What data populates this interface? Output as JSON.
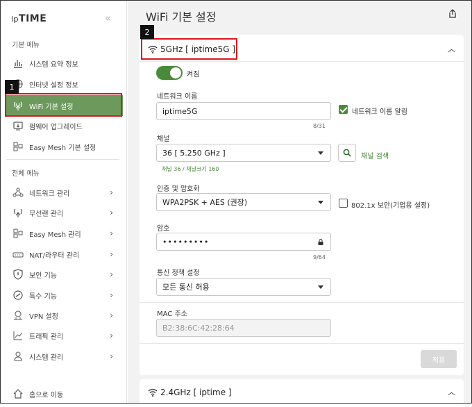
{
  "sidebar": {
    "logo_prefix": "ip",
    "logo_main": "TIME",
    "collapse_glyph": "«",
    "basic_menu_title": "기본 메뉴",
    "basic_items": [
      {
        "label": "시스템 요약 정보",
        "icon": "bar-chart-icon"
      },
      {
        "label": "인터넷 설정 정보",
        "icon": "globe-icon"
      },
      {
        "label": "WiFi 기본 설정",
        "icon": "wifi-antenna-icon"
      },
      {
        "label": "펌웨어 업그레이드",
        "icon": "firmware-icon"
      },
      {
        "label": "Easy Mesh 기본 설정",
        "icon": "mesh-icon"
      }
    ],
    "all_menu_title": "전체 메뉴",
    "all_items": [
      {
        "label": "네트워크 관리",
        "icon": "network-icon"
      },
      {
        "label": "무선랜 관리",
        "icon": "wireless-icon"
      },
      {
        "label": "Easy Mesh 관리",
        "icon": "mesh-icon"
      },
      {
        "label": "NAT/라우터 관리",
        "icon": "router-icon"
      },
      {
        "label": "보안 기능",
        "icon": "shield-icon"
      },
      {
        "label": "특수 기능",
        "icon": "special-icon"
      },
      {
        "label": "VPN 설정",
        "icon": "vpn-icon"
      },
      {
        "label": "트래픽 관리",
        "icon": "traffic-icon"
      },
      {
        "label": "시스템 관리",
        "icon": "system-icon"
      }
    ],
    "home_label": "홈으로 이동"
  },
  "badges": {
    "one": "1",
    "two": "2"
  },
  "main": {
    "title": "WiFi 기본 설정",
    "band5": {
      "header": "5GHz [ iptime5G ]",
      "toggle_label": "켜짐",
      "network_name_label": "네트워크 이름",
      "network_name_value": "iptime5G",
      "network_name_counter": "8/31",
      "show_name_label": "네트워크 이름 알림",
      "channel_label": "채널",
      "channel_value": "36 [ 5.250 GHz ]",
      "channel_hint": "채널 36 / 채널크기 160",
      "channel_search_label": "채널 검색",
      "auth_label": "인증 및 암호화",
      "auth_value": "WPA2PSK + AES (권장)",
      "enterprise_label": "802.1x 보안(기업용 설정)",
      "password_label": "암호",
      "password_value": "•••••••••",
      "password_counter": "9/64",
      "policy_label": "통신 정책 설정",
      "policy_value": "모든 통신 허용",
      "mac_label": "MAC 주소",
      "mac_value": "B2:38:6C:42:28:64",
      "apply_label": "적용"
    },
    "band24": {
      "header": "2.4GHz [ iptime ]"
    }
  },
  "colors": {
    "accent": "#4a8a3a",
    "active_nav": "#6d9a5c",
    "highlight": "#e0141c"
  }
}
